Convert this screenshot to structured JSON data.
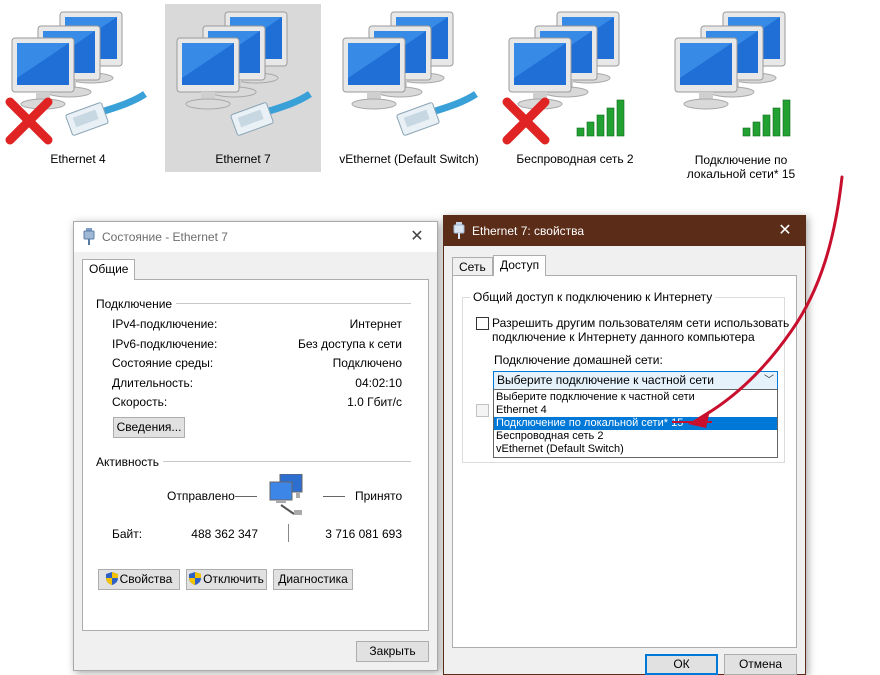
{
  "adapters": [
    {
      "label": "Ethernet 4",
      "status": "disconnected",
      "kind": "ethernet",
      "selected": false
    },
    {
      "label": "Ethernet 7",
      "status": "connected",
      "kind": "ethernet",
      "selected": true
    },
    {
      "label": "vEthernet (Default Switch)",
      "status": "connected",
      "kind": "ethernet",
      "selected": false
    },
    {
      "label": "Беспроводная сеть 2",
      "status": "disconnected",
      "kind": "wireless",
      "selected": false
    },
    {
      "label_line1": "Подключение по",
      "label_line2": "локальной сети* 15",
      "status": "connected",
      "kind": "wireless",
      "selected": false
    }
  ],
  "status_window": {
    "title": "Состояние - Ethernet 7",
    "tab_general": "Общие",
    "section_connection": "Подключение",
    "rows": [
      {
        "label": "IPv4-подключение:",
        "value": "Интернет"
      },
      {
        "label": "IPv6-подключение:",
        "value": "Без доступа к сети"
      },
      {
        "label": "Состояние среды:",
        "value": "Подключено"
      },
      {
        "label": "Длительность:",
        "value": "04:02:10"
      },
      {
        "label": "Скорость:",
        "value": "1.0 Гбит/с"
      }
    ],
    "details_button": "Сведения...",
    "section_activity": "Активность",
    "sent_label": "Отправлено",
    "received_label": "Принято",
    "bytes_label": "Байт:",
    "bytes_sent": "488 362 347",
    "bytes_received": "3 716 081 693",
    "properties_button": "Свойства",
    "disable_button": "Отключить",
    "diagnose_button": "Диагностика",
    "close_button": "Закрыть"
  },
  "props_window": {
    "title": "Ethernet 7: свойства",
    "tab_network": "Сеть",
    "tab_sharing": "Доступ",
    "group_title": "Общий доступ к подключению к Интернету",
    "allow_share_line1": "Разрешить другим пользователям сети использовать",
    "allow_share_line2": "подключение к Интернету данного компьютера",
    "home_network_label": "Подключение домашней сети:",
    "combo_value": "Выберите подключение к частной сети",
    "options": [
      "Выберите подключение к частной сети",
      "Ethernet 4",
      "Подключение по локальной сети* 15",
      "Беспроводная сеть 2",
      "vEthernet (Default Switch)"
    ],
    "highlighted_index": 2,
    "ok_button": "ОК",
    "cancel_button": "Отмена"
  },
  "colors": {
    "accent": "#0078d7",
    "props_titlebar": "#5b2c17",
    "arrow": "#c8102e",
    "error_x": "#e02424",
    "signal": "#22a032"
  }
}
